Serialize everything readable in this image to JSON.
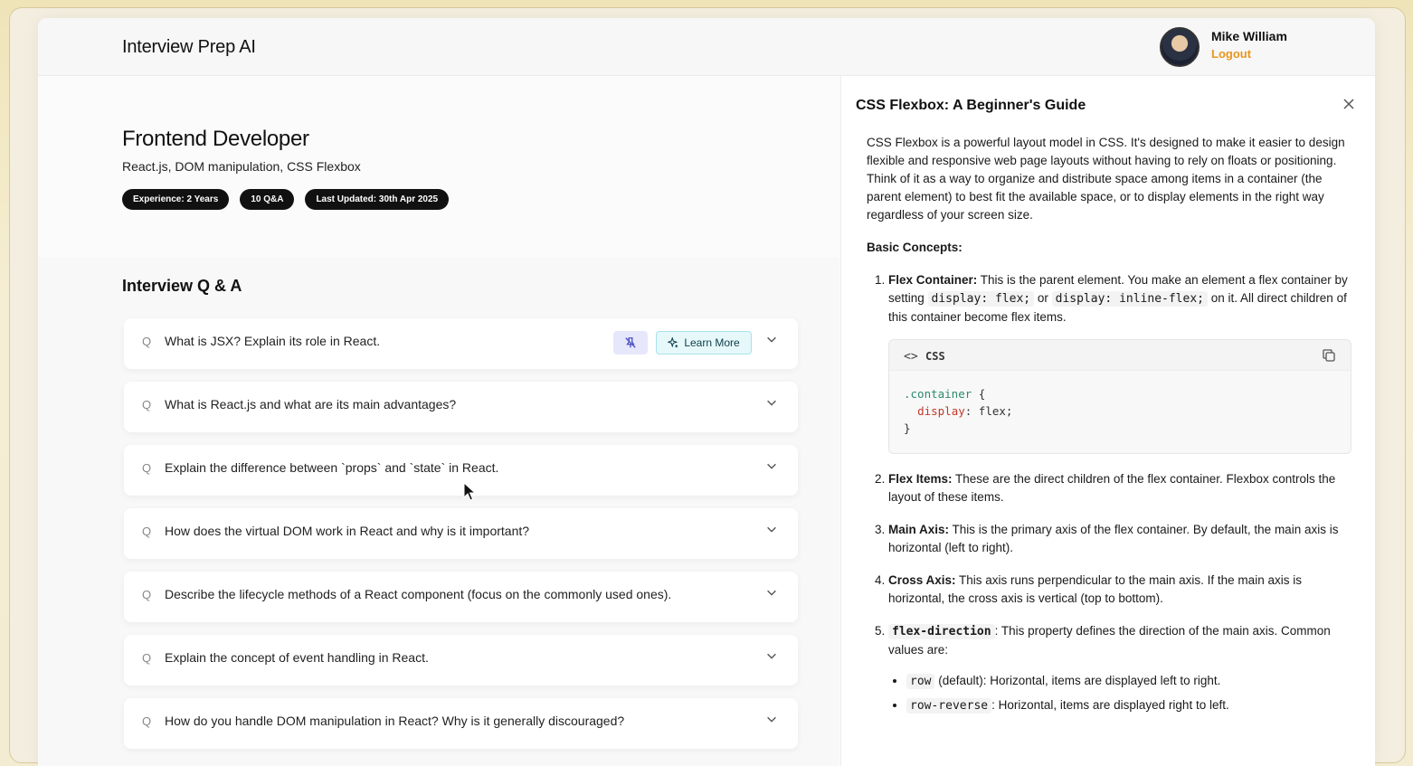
{
  "header": {
    "brand": "Interview Prep AI",
    "user_name": "Mike William",
    "logout_label": "Logout"
  },
  "session": {
    "role": "Frontend Developer",
    "topics": "React.js, DOM manipulation, CSS Flexbox",
    "pills": [
      "Experience: 2 Years",
      "10 Q&A",
      "Last Updated: 30th Apr 2025"
    ]
  },
  "qa": {
    "heading": "Interview Q & A",
    "q_mark": "Q",
    "learn_more_label": "Learn More",
    "items": [
      "What is JSX? Explain its role in React.",
      "What is React.js and what are its main advantages?",
      "Explain the difference between `props` and `state` in React.",
      "How does the virtual DOM work in React and why is it important?",
      "Describe the lifecycle methods of a React component (focus on the commonly used ones).",
      "Explain the concept of event handling in React.",
      "How do you handle DOM manipulation in React? Why is it generally discouraged?"
    ]
  },
  "drawer": {
    "title": "CSS Flexbox: A Beginner's Guide",
    "intro": "CSS Flexbox is a powerful layout model in CSS. It's designed to make it easier to design flexible and responsive web page layouts without having to rely on floats or positioning. Think of it as a way to organize and distribute space among items in a container (the parent element) to best fit the available space, or to display elements in the right way regardless of your screen size.",
    "basic_concepts": "Basic Concepts:",
    "c1_term": "Flex Container:",
    "c1_a": " This is the parent element. You make an element a flex container by setting ",
    "c1_code1": "display: flex;",
    "c1_b": " or ",
    "c1_code2": "display: inline-flex;",
    "c1_c": " on it. All direct children of this container become flex items.",
    "code_block": {
      "icon": "<>",
      "lang": "CSS",
      "line1_sel": ".container",
      "line1_rest": " {",
      "line2_prop": "display",
      "line2_rest": ": flex;",
      "line3": "}"
    },
    "c2_term": "Flex Items:",
    "c2_text": " These are the direct children of the flex container. Flexbox controls the layout of these items.",
    "c3_term": "Main Axis:",
    "c3_text": " This is the primary axis of the flex container. By default, the main axis is horizontal (left to right).",
    "c4_term": "Cross Axis:",
    "c4_text": " This axis runs perpendicular to the main axis. If the main axis is horizontal, the cross axis is vertical (top to bottom).",
    "c5_code": "flex-direction",
    "c5_text": ": This property defines the direction of the main axis. Common values are:",
    "v1_code": "row",
    "v1_text": " (default): Horizontal, items are displayed left to right.",
    "v2_code": "row-reverse",
    "v2_text": ": Horizontal, items are displayed right to left."
  }
}
